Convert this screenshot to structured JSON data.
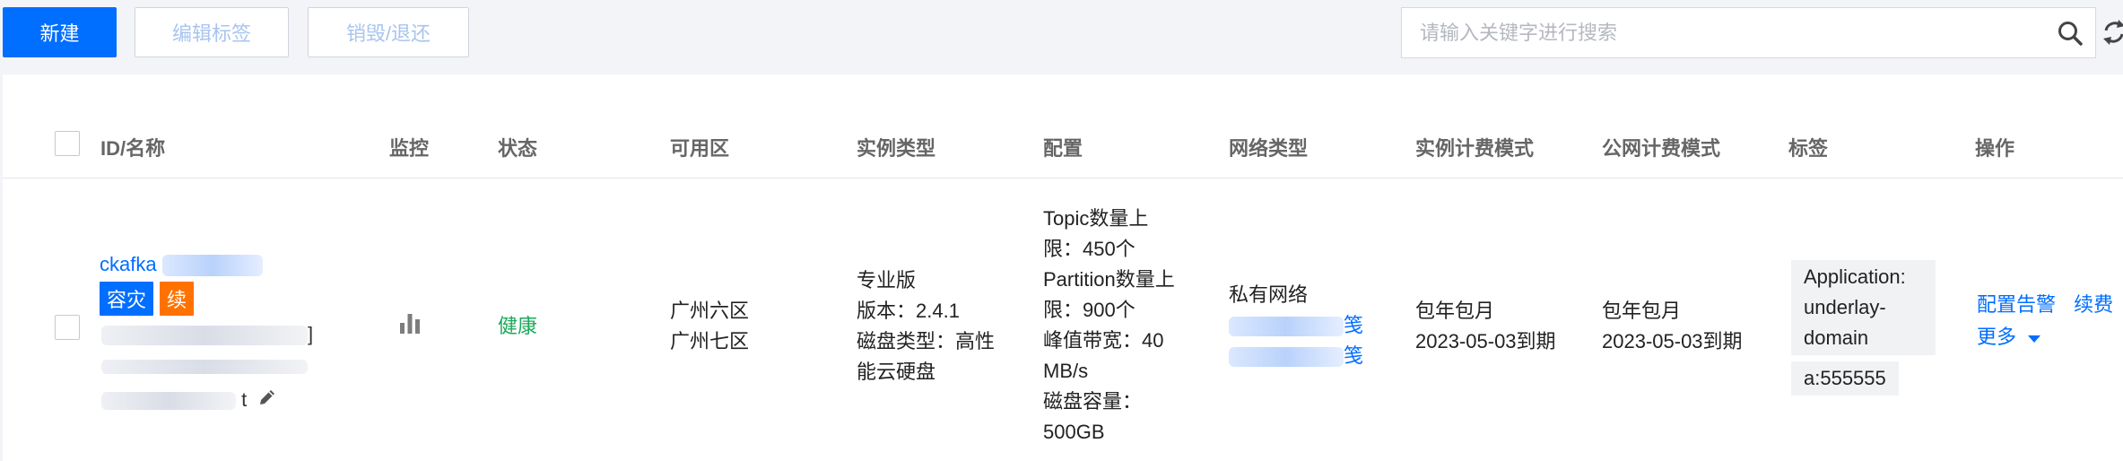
{
  "toolbar": {
    "new_label": "新建",
    "edit_tags_label": "编辑标签",
    "destroy_label": "销毁/退还"
  },
  "search": {
    "placeholder": "请输入关键字进行搜索"
  },
  "colors": {
    "primary": "#006eff",
    "success": "#1ca95a",
    "tag_disaster": "#006eff",
    "tag_renew": "#ff7200"
  },
  "table": {
    "columns": {
      "id_name": "ID/名称",
      "monitor": "监控",
      "status": "状态",
      "zone": "可用区",
      "instance_type": "实例类型",
      "config": "配置",
      "network_type": "网络类型",
      "billing_mode": "实例计费模式",
      "public_billing_mode": "公网计费模式",
      "tags": "标签",
      "actions": "操作"
    },
    "rows": [
      {
        "name_prefix": "ckafka",
        "badge_disaster": "容灾",
        "badge_renew": "续",
        "id_suffix_char": "]",
        "remark_suffix": "t",
        "status": "健康",
        "zone_lines": [
          "广州六区",
          "广州七区"
        ],
        "type_lines": [
          "专业版",
          "版本：2.4.1",
          "磁盘类型：高性",
          "能云硬盘"
        ],
        "config_lines": [
          "Topic数量上",
          "限：450个",
          "Partition数量上",
          "限：900个",
          "峰值带宽：40",
          "MB/s",
          "磁盘容量：",
          "500GB"
        ],
        "network_label": "私有网络",
        "network_suffix_1": "笺",
        "network_suffix_2": "笺",
        "billing_mode": "包年包月",
        "billing_expiry": "2023-05-03到期",
        "public_billing_mode": "包年包月",
        "public_billing_expiry": "2023-05-03到期",
        "tag_lines": [
          "Application:",
          "underlay-",
          "domain"
        ],
        "tag_2": "a:555555",
        "action_alarm": "配置告警",
        "action_renew": "续费",
        "action_more": "更多"
      }
    ]
  }
}
